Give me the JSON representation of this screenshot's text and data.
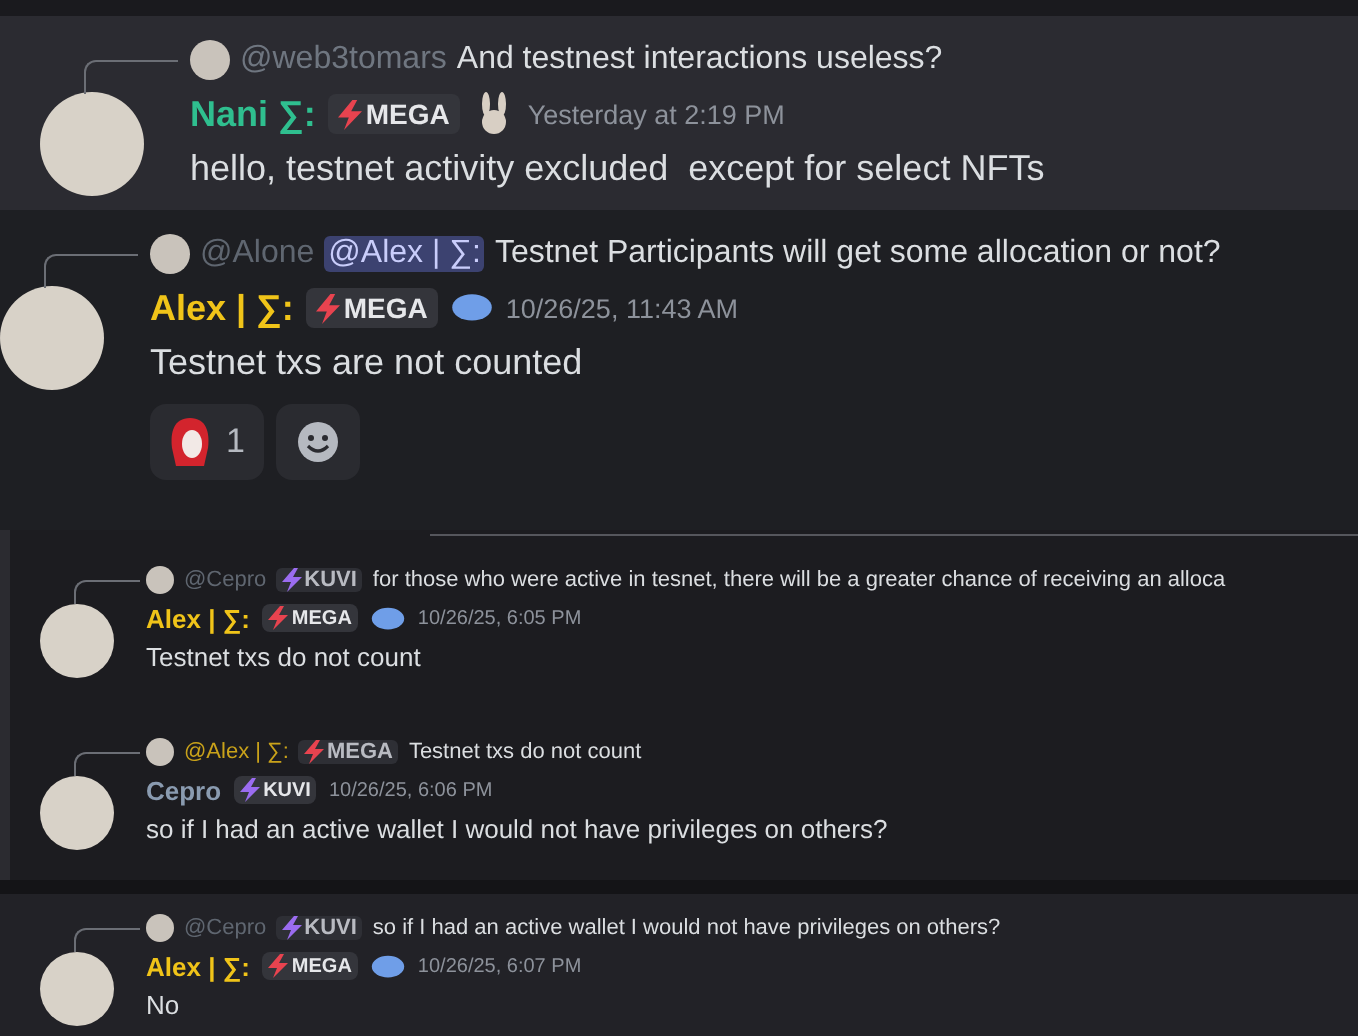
{
  "panels": [
    {
      "kind": "large",
      "reply": {
        "author": {
          "name": "@web3tomars",
          "color": "#6f7680"
        },
        "text": "And testnest interactions useless?"
      },
      "author": {
        "name": "Nani ∑:",
        "color": "#2fbf8f"
      },
      "badge": {
        "label": "MEGA",
        "color": "#e8434f"
      },
      "decoration": {
        "kind": "bunny"
      },
      "timestamp": "Yesterday at 2:19 PM",
      "content": "hello, testnet activity excluded  except for select NFTs"
    },
    {
      "kind": "large",
      "reply": {
        "author": {
          "name": "@Alone",
          "color": "#5f6670"
        },
        "mention": "@Alex | ∑:",
        "text": "Testnet Participants will get some allocation or not?"
      },
      "author": {
        "name": "Alex | ∑:",
        "color": "#f0c419"
      },
      "badge": {
        "label": "MEGA",
        "color": "#e8434f"
      },
      "decoration": {
        "kind": "blob"
      },
      "timestamp": "10/26/25, 11:43 AM",
      "content": "Testnet txs are not counted",
      "reactions": [
        {
          "kind": "emoji",
          "count": "1"
        },
        {
          "kind": "add"
        }
      ]
    },
    {
      "kind": "small",
      "reply": {
        "author": {
          "name": "@Cepro",
          "color": "#5f6670"
        },
        "tag": {
          "label": "KUVI",
          "color": "#9b6cf0"
        },
        "text": "for those who were active in tesnet, there will be a greater chance of receiving an alloca"
      },
      "author": {
        "name": "Alex | ∑:",
        "color": "#f0c419"
      },
      "badge": {
        "label": "MEGA",
        "color": "#e8434f"
      },
      "decoration": {
        "kind": "blob"
      },
      "timestamp": "10/26/25, 6:05 PM",
      "content": "Testnet txs do not count"
    },
    {
      "kind": "small",
      "reply": {
        "author": {
          "name": "@Alex | ∑:",
          "color": "#c9a21a"
        },
        "tag": {
          "label": "MEGA",
          "color": "#e8434f"
        },
        "text": "Testnet txs do not count"
      },
      "author": {
        "name": "Cepro",
        "color": "#8a9bb0"
      },
      "badge": {
        "label": "KUVI",
        "color": "#9b6cf0"
      },
      "timestamp": "10/26/25, 6:06 PM",
      "content": "so if I had an active wallet I would not have privileges on others?"
    },
    {
      "kind": "small",
      "reply": {
        "author": {
          "name": "@Cepro",
          "color": "#5f6670"
        },
        "tag": {
          "label": "KUVI",
          "color": "#9b6cf0"
        },
        "text": "so if I had an active wallet I would not have privileges on others?"
      },
      "author": {
        "name": "Alex | ∑:",
        "color": "#f0c419"
      },
      "badge": {
        "label": "MEGA",
        "color": "#e8434f"
      },
      "decoration": {
        "kind": "blob"
      },
      "timestamp": "10/26/25, 6:07 PM",
      "content": "No"
    }
  ]
}
